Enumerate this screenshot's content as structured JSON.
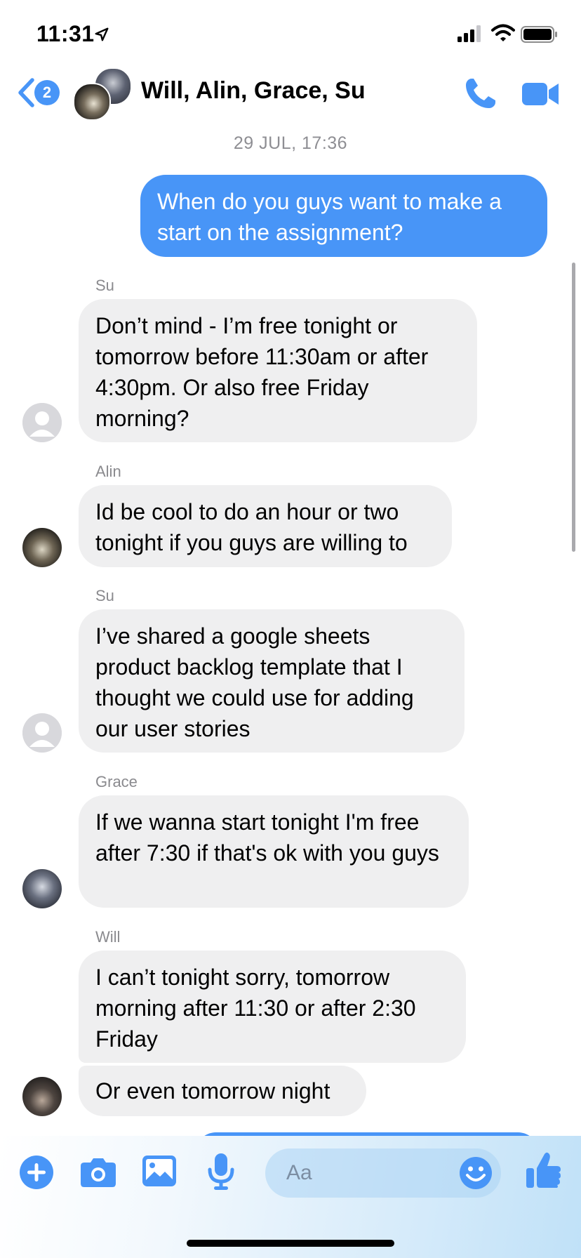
{
  "status_bar": {
    "time": "11:31"
  },
  "header": {
    "back_badge": "2",
    "title": "Will, Alin, Grace, Su"
  },
  "timestamp": "29 JUL, 17:36",
  "messages": [
    {
      "type": "outgoing",
      "text": "When do you guys want to make a start on the assignment?"
    },
    {
      "sender": "Su",
      "text": "Don’t mind - I’m free tonight or tomorrow before 11:30am or after 4:30pm. Or also free Friday morning?"
    },
    {
      "sender": "Alin",
      "text": "Id be cool to do an hour or two tonight if you guys are willing to"
    },
    {
      "sender": "Su",
      "text": "I’ve shared a google sheets product backlog template that I thought we could use for adding our user stories"
    },
    {
      "sender": "Grace",
      "text": "If we wanna start tonight I'm free after 7:30 if that's ok with you guys"
    },
    {
      "sender": "Will",
      "text": "I can’t tonight sorry, tomorrow morning after 11:30 or after 2:30 Friday"
    },
    {
      "text": "Or even tomorrow night"
    }
  ],
  "composer": {
    "placeholder": "Aa"
  },
  "colors": {
    "accent": "#4895f7",
    "incoming_bubble": "#efeff0",
    "meta_text": "#8e8e93"
  },
  "icons": [
    "location-arrow-icon",
    "signal-icon",
    "wifi-icon",
    "battery-icon",
    "back-chevron-icon",
    "phone-icon",
    "video-camera-icon",
    "plus-icon",
    "camera-icon",
    "photo-icon",
    "microphone-icon",
    "emoji-icon",
    "thumbs-up-icon"
  ]
}
